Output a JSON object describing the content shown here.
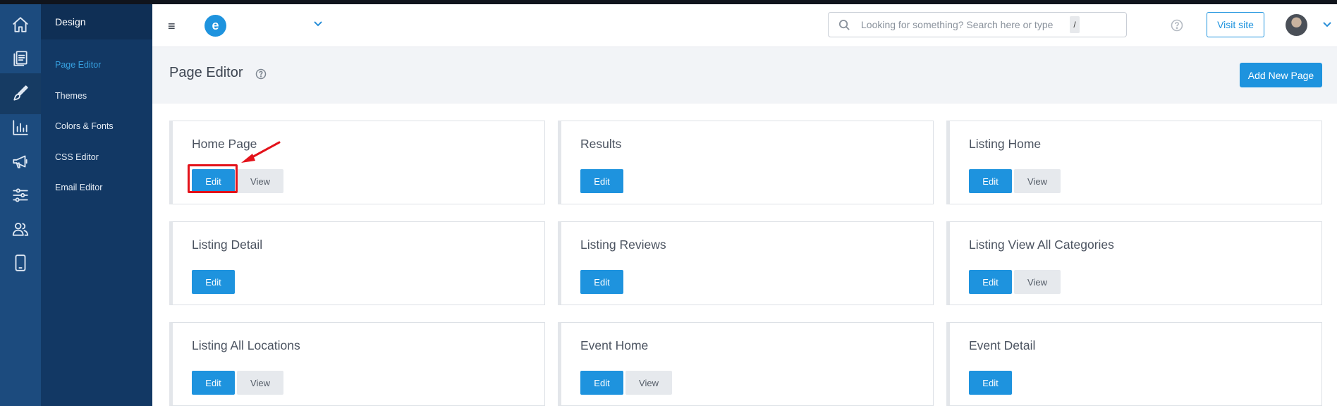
{
  "sidebar_icons": [
    "home-icon",
    "pages-icon",
    "brush-icon",
    "chart-icon",
    "megaphone-icon",
    "sliders-icon",
    "users-icon",
    "mobile-icon"
  ],
  "subnav": {
    "heading": "Design",
    "items": [
      {
        "label": "Page Editor",
        "active": true
      },
      {
        "label": "Themes",
        "active": false
      },
      {
        "label": "Colors & Fonts",
        "active": false
      },
      {
        "label": "CSS Editor",
        "active": false
      },
      {
        "label": "Email Editor",
        "active": false
      }
    ]
  },
  "topbar": {
    "menu_glyph": "≡",
    "logo_letter": "e",
    "search_placeholder": "Looking for something? Search here or type",
    "search_shortcut": "/",
    "visit_label": "Visit site"
  },
  "page": {
    "title": "Page Editor",
    "add_button": "Add New Page"
  },
  "cards": [
    {
      "title": "Home Page",
      "edit": "Edit",
      "view": "View"
    },
    {
      "title": "Results",
      "edit": "Edit",
      "view": ""
    },
    {
      "title": "Listing Home",
      "edit": "Edit",
      "view": "View"
    },
    {
      "title": "Listing Detail",
      "edit": "Edit",
      "view": ""
    },
    {
      "title": "Listing Reviews",
      "edit": "Edit",
      "view": ""
    },
    {
      "title": "Listing View All Categories",
      "edit": "Edit",
      "view": "View"
    },
    {
      "title": "Listing All Locations",
      "edit": "Edit",
      "view": "View"
    },
    {
      "title": "Event Home",
      "edit": "Edit",
      "view": "View"
    },
    {
      "title": "Event Detail",
      "edit": "Edit",
      "view": ""
    }
  ],
  "colors": {
    "accent": "#1e93de",
    "rail": "#1c4b7e",
    "subnav": "#123864",
    "annotation": "#e3121a"
  }
}
